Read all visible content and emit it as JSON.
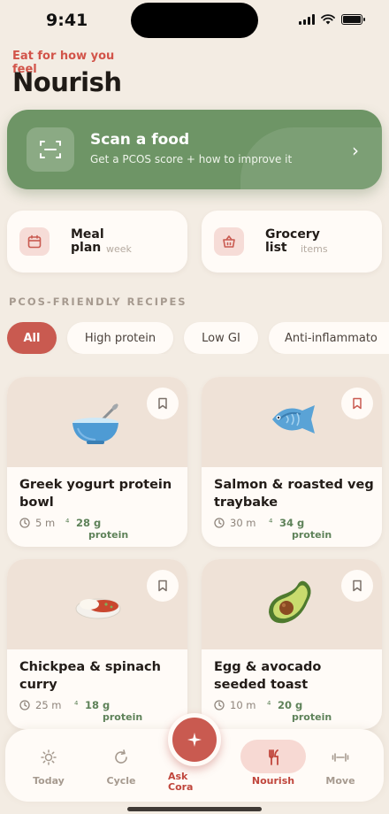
{
  "status": {
    "time": "9:41"
  },
  "header": {
    "eyebrow": "Eat for how you feel",
    "title": "Nourish"
  },
  "scan": {
    "title": "Scan a food",
    "subtitle": "Get a PCOS score + how to improve it",
    "icon": "scan-frame-icon",
    "chevron": "›"
  },
  "quick": [
    {
      "title": "Meal plan",
      "subtitle": "week",
      "icon": "calendar-icon"
    },
    {
      "title": "Grocery list",
      "subtitle": "items",
      "icon": "basket-icon"
    }
  ],
  "section_label": "PCOS-FRIENDLY RECIPES",
  "filters": [
    "All",
    "High protein",
    "Low GI",
    "Anti-inflammato"
  ],
  "active_filter": "All",
  "recipes": [
    {
      "title": "Greek yogurt protein bowl",
      "time": "5 m",
      "protein_g": "28 g",
      "protein_label": "protein",
      "emoji": "🥣",
      "icon": "bowl-icon"
    },
    {
      "title": "Salmon & roasted veg traybake",
      "time": "30 m",
      "protein_g": "34 g",
      "protein_label": "protein",
      "emoji": "🐟",
      "icon": "fish-icon"
    },
    {
      "title": "Chickpea & spinach curry",
      "time": "25 m",
      "protein_g": "18 g",
      "protein_label": "protein",
      "emoji": "🍛",
      "icon": "curry-icon"
    },
    {
      "title": "Egg & avocado seeded toast",
      "time": "10 m",
      "protein_g": "20 g",
      "protein_label": "protein",
      "emoji": "🥑",
      "icon": "avocado-icon"
    }
  ],
  "tabs": [
    {
      "label": "Today",
      "icon": "sun-icon"
    },
    {
      "label": "Cycle",
      "icon": "cycle-icon"
    },
    {
      "label": "Ask Cora",
      "icon": "sparkle-icon"
    },
    {
      "label": "Nourish",
      "icon": "utensils-icon"
    },
    {
      "label": "Move",
      "icon": "dumbbell-icon"
    }
  ],
  "active_tab": "Nourish",
  "colors": {
    "background": "#F3ECE3",
    "accent": "#C95A50",
    "green": "#6E9566",
    "card": "#FFFBF7"
  }
}
